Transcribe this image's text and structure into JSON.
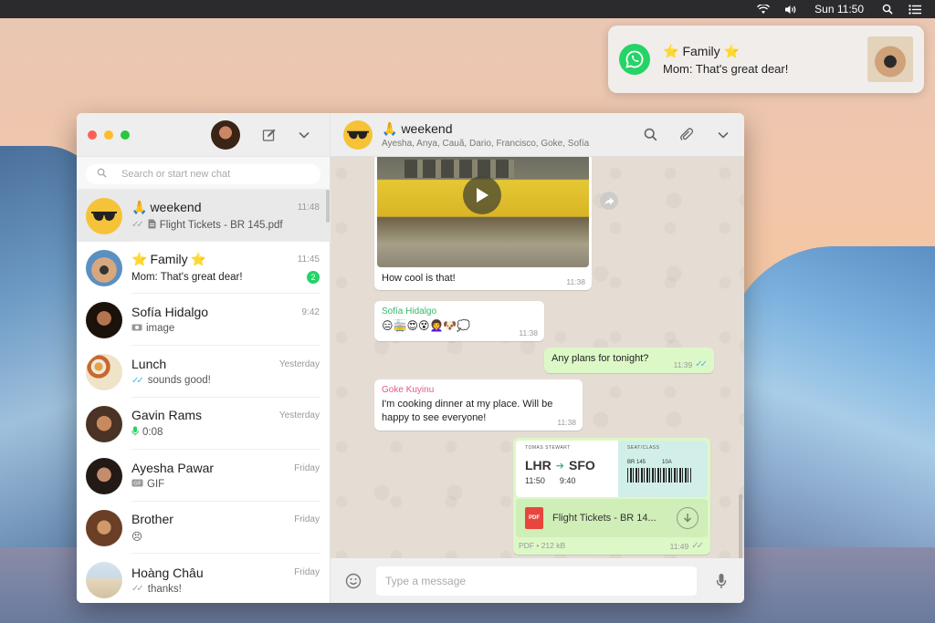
{
  "menubar": {
    "clock": "Sun 11:50",
    "icons": [
      "wifi-icon",
      "volume-icon",
      "spotlight-search-icon",
      "notification-center-icon"
    ]
  },
  "notification": {
    "app_icon": "whatsapp-logo-icon",
    "title": "Family",
    "title_star_left": "⭐",
    "title_star_right": "⭐",
    "body": "Mom: That's great dear!"
  },
  "sidebar": {
    "search_placeholder": "Search or start new chat",
    "chats": [
      {
        "name": "weekend",
        "name_prefix": "🙏",
        "time": "11:48",
        "preview": "Flight Tickets - BR 145.pdf",
        "ticks": "✓✓",
        "preview_icon": "document-icon",
        "active": true
      },
      {
        "name": "Family",
        "name_prefix": "⭐",
        "name_suffix": "⭐",
        "time": "11:45",
        "preview": "Mom: That's great dear!",
        "unread": "2"
      },
      {
        "name": "Sofía Hidalgo",
        "time": "9:42",
        "preview": "image",
        "preview_icon": "camera-icon"
      },
      {
        "name": "Lunch",
        "time": "Yesterday",
        "preview": "sounds good!",
        "ticks": "✓✓"
      },
      {
        "name": "Gavin Rams",
        "time": "Yesterday",
        "preview": "0:08",
        "preview_icon": "microphone-icon"
      },
      {
        "name": "Ayesha Pawar",
        "time": "Friday",
        "preview": "GIF",
        "preview_icon": "gif-icon"
      },
      {
        "name": "Brother",
        "time": "Friday",
        "preview": "😣"
      },
      {
        "name": "Hoàng Châu",
        "time": "Friday",
        "preview": "thanks!",
        "ticks": "✓✓"
      }
    ]
  },
  "conversation": {
    "title": "weekend",
    "title_prefix": "🙏",
    "members": "Ayesha, Anya, Cauã, Dario, Francisco, Goke, Sofía",
    "messages": {
      "video": {
        "caption": "How cool is that!",
        "time": "11:38"
      },
      "sofia": {
        "sender": "Sofía Hidalgo",
        "emojis": "😑🚋😍😵👩‍🦱🐶💭",
        "time": "11:38"
      },
      "plans": {
        "text": "Any plans for tonight?",
        "time": "11:39",
        "ticks": "✓✓"
      },
      "goke": {
        "sender": "Goke Kuyinu",
        "text": "I'm cooking dinner at my place. Will be happy to see everyone!",
        "time": "11:38"
      },
      "pdf": {
        "ticket_header_left": "TOMAS STEWART",
        "ticket_header_right": "SEAT/CLASS",
        "from": "LHR",
        "to": "SFO",
        "depart": "11:50",
        "arrive": "9:40",
        "flight": "BR 145",
        "seat": "10A",
        "file_name": "Flight Tickets - BR 14...",
        "file_badge": "PDF",
        "meta": "PDF • 212 kB",
        "time": "11:49",
        "ticks": "✓✓"
      }
    },
    "composer_placeholder": "Type a message"
  }
}
